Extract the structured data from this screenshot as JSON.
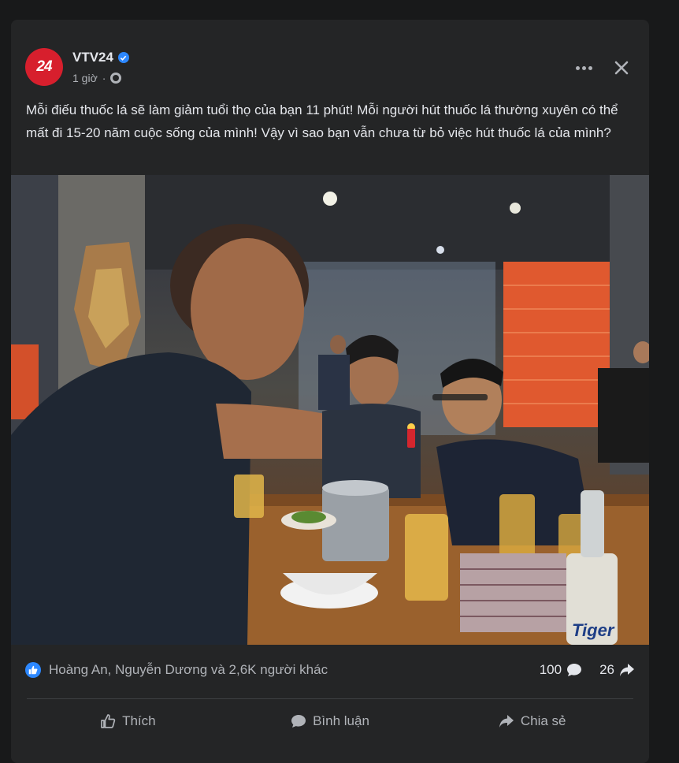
{
  "post": {
    "page_name": "VTV24",
    "avatar_text": "24",
    "time": "1 giờ",
    "text": "Mỗi điếu thuốc lá sẽ làm giảm tuổi thọ của bạn 11 phút! Mỗi người hút thuốc lá thường xuyên có thể mất đi 15-20 năm cuộc sống của mình! Vậy vì sao bạn vẫn chưa từ bỏ việc hút thuốc lá của mình?",
    "photo_description": "",
    "photo_beer_label": "Tiger"
  },
  "stats": {
    "reactions_text": "Hoàng An, Nguyễn Dương và 2,6K người khác",
    "comments": "100",
    "shares": "26"
  },
  "actions": {
    "like": "Thích",
    "comment": "Bình luận",
    "share": "Chia sẻ"
  },
  "colors": {
    "card_bg": "#242526",
    "page_bg": "#18191a",
    "accent": "#2d88ff",
    "avatar": "#d71f2d"
  }
}
